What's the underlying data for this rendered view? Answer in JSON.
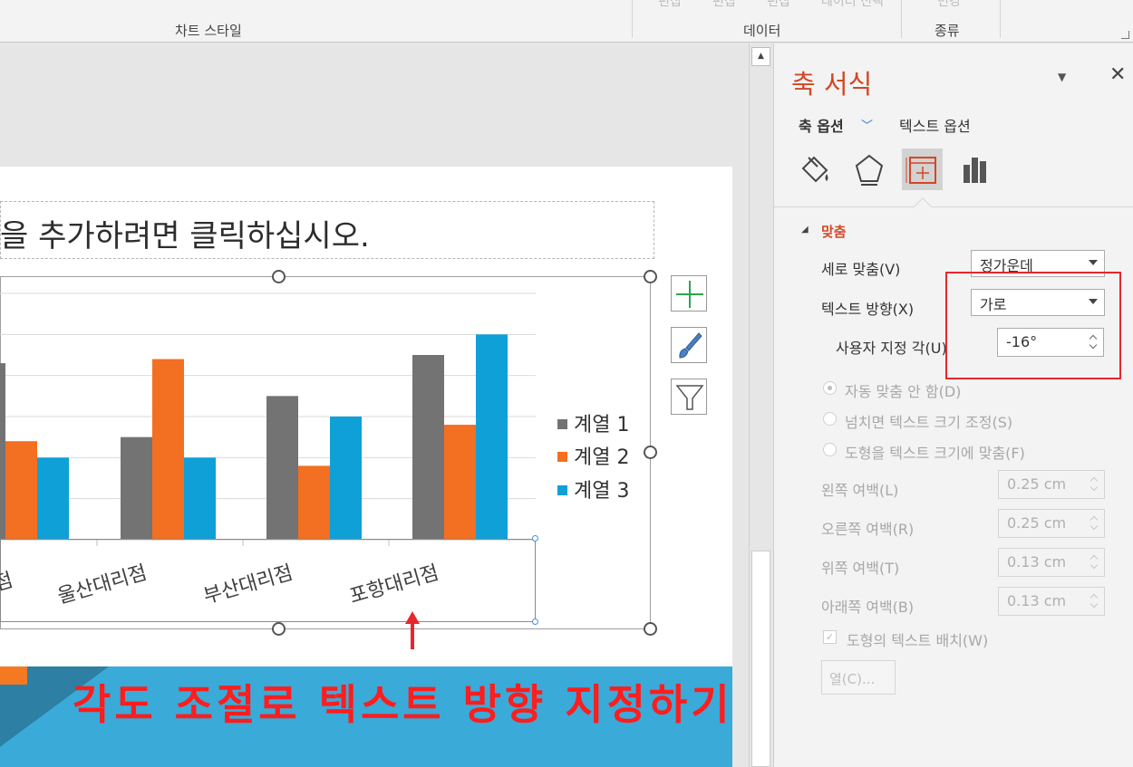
{
  "ribbon": {
    "groups": [
      "차트 스타일",
      "데이터",
      "종류"
    ],
    "faded_top_labels": [
      "편집",
      "편집",
      "편집",
      "데이터 선택",
      "변경"
    ]
  },
  "slide": {
    "title_placeholder": "을 추가하려면 클릭하십시오.",
    "caption": "각도 조절로 텍스트 방향 지정하기"
  },
  "chart_data": {
    "type": "bar",
    "categories": [
      "점",
      "울산대리점",
      "부산대리점",
      "포항대리점"
    ],
    "series": [
      {
        "name": "계열 1",
        "values": [
          4.3,
          2.5,
          3.5,
          4.5
        ]
      },
      {
        "name": "계열 2",
        "values": [
          2.4,
          4.4,
          1.8,
          2.8
        ]
      },
      {
        "name": "계열 3",
        "values": [
          2.0,
          2.0,
          3.0,
          5.0
        ]
      }
    ],
    "colors": [
      "#737373",
      "#f36f21",
      "#0fa0d8"
    ],
    "ylim": [
      0,
      6
    ],
    "grid": true,
    "legend_position": "right",
    "x_label_rotation": "-16°"
  },
  "chart_buttons": [
    "chart-elements",
    "chart-styles",
    "chart-filters"
  ],
  "pane": {
    "title": "축 서식",
    "tab_axis_options": "축 옵션",
    "tab_text_options": "텍스트 옵션",
    "section_title": "맞춤",
    "vertical_align_label": "세로 맞춤(V)",
    "vertical_align_value": "정가운데",
    "text_direction_label": "텍스트 방향(X)",
    "text_direction_value": "가로",
    "custom_angle_label": "사용자 지정 각(U)",
    "custom_angle_value": "-16°",
    "radio_autofit_off": "자동 맞춤 안 함(D)",
    "radio_shrink": "넘치면 텍스트 크기 조정(S)",
    "radio_resize": "도형을 텍스트 크기에 맞춤(F)",
    "left_margin_label": "왼쪽 여백(L)",
    "left_margin_value": "0.25 cm",
    "right_margin_label": "오른쪽 여백(R)",
    "right_margin_value": "0.25 cm",
    "top_margin_label": "위쪽 여백(T)",
    "top_margin_value": "0.13 cm",
    "bottom_margin_label": "아래쪽 여백(B)",
    "bottom_margin_value": "0.13 cm",
    "wrap_text_label": "도형의 텍스트 배치(W)",
    "columns_button": "열(C)..."
  },
  "colors": {
    "accent": "#d24726",
    "highlight_box": "#e8262d",
    "caption": "#ff1d1d",
    "banner": "#3aaad8"
  }
}
